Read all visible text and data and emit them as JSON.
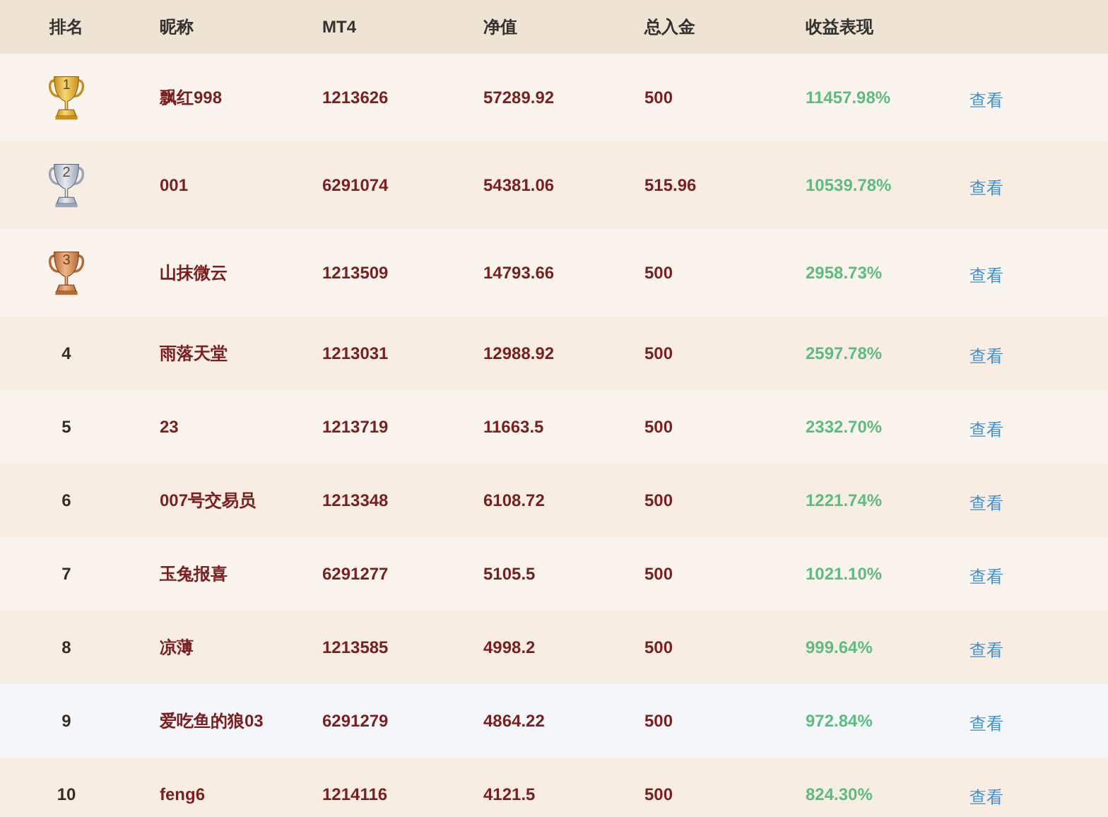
{
  "table": {
    "columns": [
      "排名",
      "昵称",
      "MT4",
      "净值",
      "总入金",
      "收益表现"
    ],
    "rows": [
      {
        "rank": "1",
        "kind": "gold",
        "nickname": "飘红998",
        "mt4": "1213626",
        "equity": "57289.92",
        "deposit": "500",
        "performance": "11457.98%",
        "action": "查看",
        "highlighted": false
      },
      {
        "rank": "2",
        "kind": "silver",
        "nickname": "001",
        "mt4": "6291074",
        "equity": "54381.06",
        "deposit": "515.96",
        "performance": "10539.78%",
        "action": "查看",
        "highlighted": false
      },
      {
        "rank": "3",
        "kind": "bronze",
        "nickname": "山抹微云",
        "mt4": "1213509",
        "equity": "14793.66",
        "deposit": "500",
        "performance": "2958.73%",
        "action": "查看",
        "highlighted": false
      },
      {
        "rank": "4",
        "kind": "plain",
        "nickname": "雨落天堂",
        "mt4": "1213031",
        "equity": "12988.92",
        "deposit": "500",
        "performance": "2597.78%",
        "action": "查看",
        "highlighted": false
      },
      {
        "rank": "5",
        "kind": "plain",
        "nickname": "23",
        "mt4": "1213719",
        "equity": "11663.5",
        "deposit": "500",
        "performance": "2332.70%",
        "action": "查看",
        "highlighted": false
      },
      {
        "rank": "6",
        "kind": "plain",
        "nickname": "007号交易员",
        "mt4": "1213348",
        "equity": "6108.72",
        "deposit": "500",
        "performance": "1221.74%",
        "action": "查看",
        "highlighted": false
      },
      {
        "rank": "7",
        "kind": "plain",
        "nickname": "玉兔报喜",
        "mt4": "6291277",
        "equity": "5105.5",
        "deposit": "500",
        "performance": "1021.10%",
        "action": "查看",
        "highlighted": false
      },
      {
        "rank": "8",
        "kind": "plain",
        "nickname": "凉薄",
        "mt4": "1213585",
        "equity": "4998.2",
        "deposit": "500",
        "performance": "999.64%",
        "action": "查看",
        "highlighted": false
      },
      {
        "rank": "9",
        "kind": "plain",
        "nickname": "爱吃鱼的狼03",
        "mt4": "6291279",
        "equity": "4864.22",
        "deposit": "500",
        "performance": "972.84%",
        "action": "查看",
        "highlighted": true
      },
      {
        "rank": "10",
        "kind": "plain",
        "nickname": "feng6",
        "mt4": "1214116",
        "equity": "4121.5",
        "deposit": "500",
        "performance": "824.30%",
        "action": "查看",
        "highlighted": false
      }
    ]
  }
}
